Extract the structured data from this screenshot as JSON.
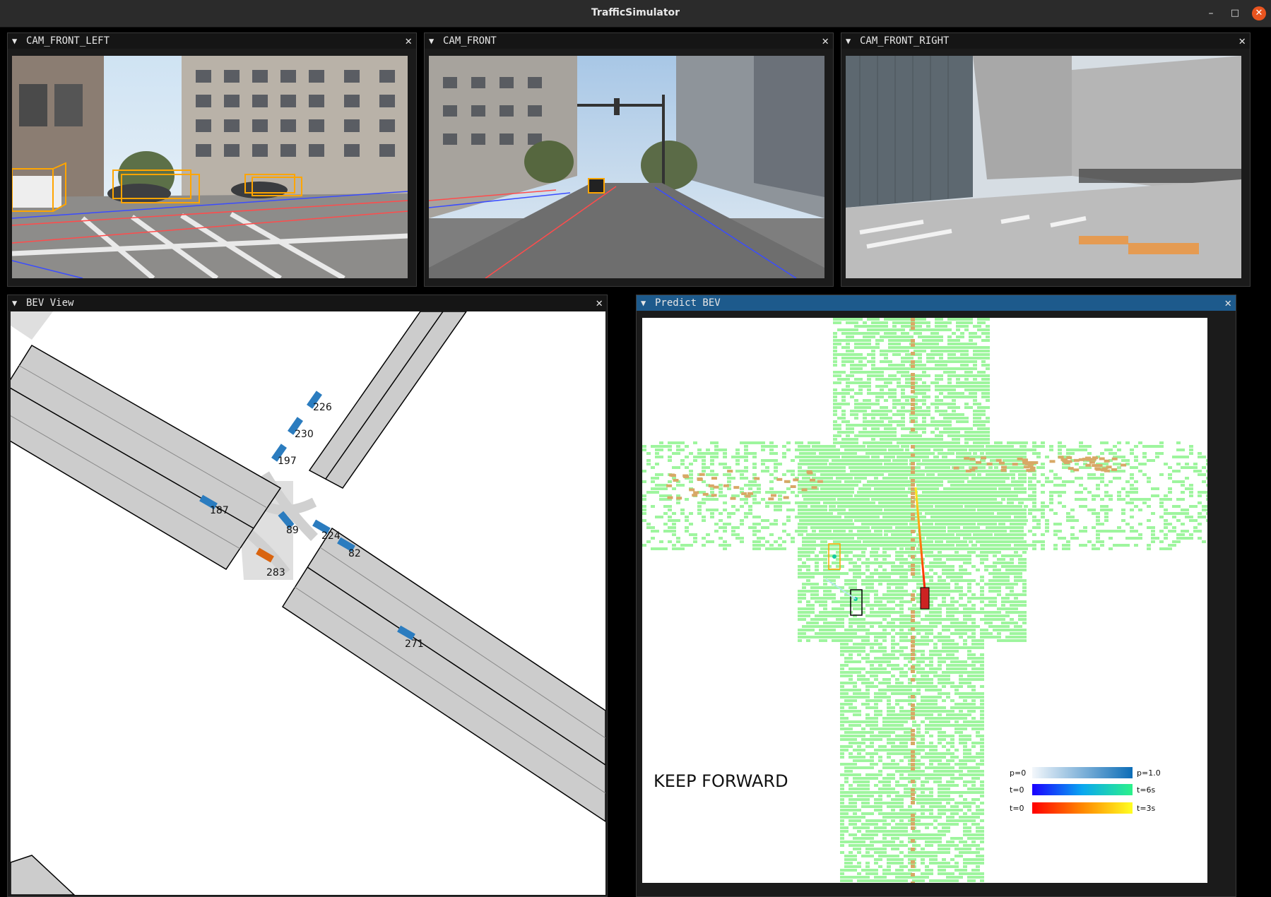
{
  "window": {
    "title": "TrafficSimulator",
    "min": "–",
    "max": "□",
    "close": "✕"
  },
  "panels": {
    "cam_front_left": {
      "title": "CAM_FRONT_LEFT",
      "collapse": "▼",
      "close": "✕"
    },
    "cam_front": {
      "title": "CAM_FRONT",
      "collapse": "▼",
      "close": "✕"
    },
    "cam_front_right": {
      "title": "CAM_FRONT_RIGHT",
      "collapse": "▼",
      "close": "✕"
    },
    "bev_view": {
      "title": "BEV View",
      "collapse": "▼",
      "close": "✕"
    },
    "predict_bev": {
      "title": "Predict BEV",
      "collapse": "▼",
      "close": "✕"
    }
  },
  "bev": {
    "agents": [
      "226",
      "230",
      "197",
      "187",
      "89",
      "224",
      "82",
      "283",
      "271"
    ]
  },
  "predict": {
    "command": "KEEP FORWARD",
    "legend": [
      {
        "left": "p=0",
        "right": "p=1.0"
      },
      {
        "left": "t=0",
        "right": "t=6s"
      },
      {
        "left": "t=0",
        "right": "t=3s"
      }
    ]
  },
  "colors": {
    "accent": "#1d5a8c",
    "bbox": "#ffa500",
    "agent": "#2b7cbf",
    "ego_agent": "#d9640f",
    "occupancy": "#9ef59e",
    "occupancy_dense": "#d8a866",
    "ego_car": "#cc2222"
  }
}
